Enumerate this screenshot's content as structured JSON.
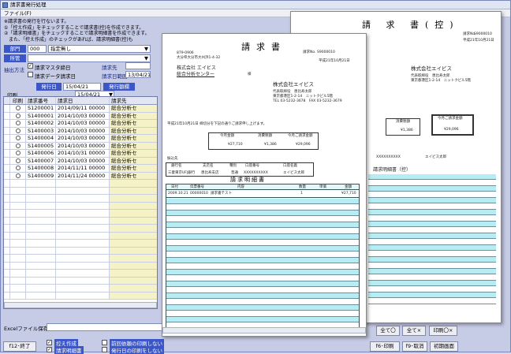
{
  "window": {
    "title": "請求書発行処理"
  },
  "menu": {
    "file": "ファイル(F)"
  },
  "notes": {
    "line1": "※請求書の発行を行ないます。",
    "line2": "①「控え作成」をチェックすることで請求書(控)を作成できます。",
    "line3": "②「請求明細書」をチェックすることで請求明細書を作成できます。",
    "line4": "　また、「控え作成」のチェックがあれば、請求明細書(控)も"
  },
  "form": {
    "dept_label": "部門",
    "dept_code": "000",
    "dept_name": "指定無し",
    "owner_label": "所管",
    "method_label": "抽出方法",
    "master_check_label": "請求マスタ締日",
    "checked_mark": "✓",
    "date_label": "請求先",
    "data_check_label": "請求データ請求日",
    "range_label": "請求日範囲",
    "range_value": "13/04/21",
    "issue_date_label": "発行日",
    "issue_date_value": "15/04/21",
    "issue_amount_label": "発行額欄",
    "print_label": "印刷",
    "print_value": "15/04/21"
  },
  "grid": {
    "headers": [
      "印刷",
      "請求番号",
      "請求日",
      "請求先"
    ],
    "rows": [
      {
        "no": "S1200001",
        "date": "2014/09/11 00000",
        "client": "総合分析セ"
      },
      {
        "no": "S1400001",
        "date": "2014/10/03 00000",
        "client": "総合分析セ"
      },
      {
        "no": "S1400002",
        "date": "2014/10/03 00000",
        "client": "総合分析セ"
      },
      {
        "no": "S1400003",
        "date": "2014/10/03 00000",
        "client": "総合分析セ"
      },
      {
        "no": "S1400004",
        "date": "2014/10/03 00000",
        "client": "総合分析セ"
      },
      {
        "no": "S1400005",
        "date": "2014/10/03 00000",
        "client": "総合分析セ"
      },
      {
        "no": "S1400006",
        "date": "2014/10/31 00000",
        "client": "総合分析セ"
      },
      {
        "no": "S1400007",
        "date": "2014/10/03 00000",
        "client": "総合分析セ"
      },
      {
        "no": "S1400008",
        "date": "2014/11/11 00000",
        "client": "総合分析セ"
      },
      {
        "no": "S1400009",
        "date": "2014/11/24 00000",
        "client": "総合分析セ"
      }
    ]
  },
  "excel": {
    "label": "Excelファイル保存先："
  },
  "bottom": {
    "f12": "f12･終了",
    "copy": "控え作成",
    "detail": "請求明細書",
    "prev_print": "前回依頼の印刷しない",
    "issue_print": "発行日の印刷をしない",
    "all_on": "全て〇",
    "all_x": "全て×",
    "print_ox": "印刷〇×",
    "f6": "f6･印刷",
    "f9": "f9･取消",
    "init": "初期画面"
  },
  "doc_front": {
    "title": "請求書",
    "postal": "879-0906",
    "addr": "大分県大分市大州浜1-4-32",
    "to_company": "株式会社 エイビス",
    "to_dept": "総合分析センター",
    "honorific": "様",
    "no_label": "請求No.",
    "no": "S9000010",
    "date": "平成21年10月21日",
    "sender": "株式会社エイビス",
    "sender_rep": "代表取締役　恵比寿太郎",
    "sender_addr": "東京都港区1-2-14　ニットクビル5階",
    "tel": "TEL 03-5232-3678　FAX 03-5232-3679",
    "greeting": "平成21年10月21日 締切分を下記の通りご請求申し上げます。",
    "amounts_h": [
      "今月金額",
      "消費税額",
      "今月ご請求金額"
    ],
    "amounts": [
      "¥27,710",
      "¥1,386",
      "¥29,096"
    ],
    "bank_label": "振込先",
    "bank_h": [
      "銀行名",
      "支店名",
      "種別",
      "口座番号",
      "口座名義"
    ],
    "bank": [
      "三菱東京UFJ銀行",
      "恵比寿支店",
      "普通",
      "XXXXXXXXXX",
      "エイビス太郎"
    ],
    "detail_title": "請求明細書",
    "detail_h": [
      "日付",
      "伝票番号",
      "内容",
      "数量",
      "単価",
      "金額"
    ],
    "detail_row": [
      "2009.10.21",
      "00000010",
      "請求書テスト",
      "1",
      "",
      "¥27,710"
    ]
  },
  "doc_back": {
    "title": "請 求 書(控)",
    "no_label": "請求No.",
    "no": "S9000010",
    "date": "平成21年10月21日",
    "sender": "株式会社エイビス",
    "sender_rep": "代表取締役　恵比寿太郎",
    "sender_addr": "東京都港区1-2-14　ニットクビル5階",
    "amounts_h": [
      "消費税額",
      "今月ご請求金額"
    ],
    "amounts": [
      "¥1,386",
      "¥29,096"
    ],
    "bank": [
      "XXXXXXXXXX",
      "エイビス太郎"
    ],
    "detail_title": "請求明細書（控）"
  }
}
